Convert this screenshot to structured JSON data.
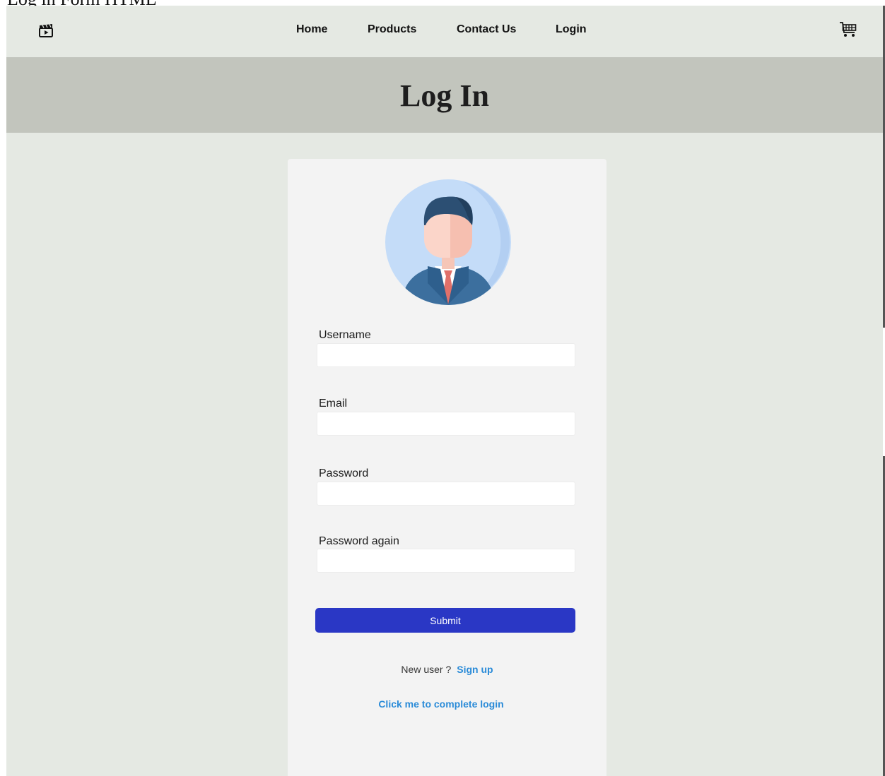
{
  "page": {
    "caption": "Log in Form HTML"
  },
  "navbar": {
    "logo_icon": "clapperboard-icon",
    "links": [
      {
        "label": "Home"
      },
      {
        "label": "Products"
      },
      {
        "label": "Contact Us"
      },
      {
        "label": "Login"
      }
    ],
    "cart_icon": "shopping-cart-icon"
  },
  "hero": {
    "title": "Log In"
  },
  "form": {
    "avatar_icon": "businessman-avatar-icon",
    "fields": [
      {
        "label": "Username",
        "value": ""
      },
      {
        "label": "Email",
        "value": ""
      },
      {
        "label": "Password",
        "value": ""
      },
      {
        "label": "Password again",
        "value": ""
      }
    ],
    "submit_label": "Submit",
    "new_user_text": "New user ?",
    "signup_label": "Sign up",
    "complete_login_label": "Click me to complete login"
  },
  "colors": {
    "page_background": "#e5e9e3",
    "hero_background": "#c2c5bd",
    "card_background": "#f3f3f3",
    "submit_button": "#2a37c5",
    "link": "#2a8bd8"
  }
}
